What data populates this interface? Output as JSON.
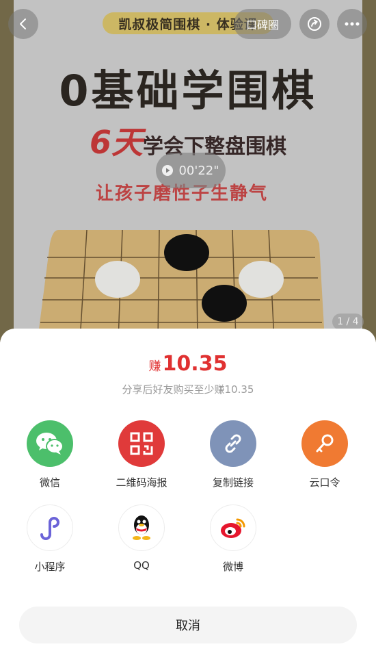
{
  "banner": {
    "tag": "凯叔极简围棋 · 体验课",
    "title": "0基础学围棋",
    "subtitle_num": "6天",
    "subtitle_rest": "学会下整盘围棋",
    "slogan": "让孩子磨性子生静气",
    "audio_duration": "00'22\"",
    "page_indicator": "1 / 4",
    "koubei_label": "口碑圈"
  },
  "share": {
    "earn_label": "赚",
    "earn_amount": "10.35",
    "earn_desc": "分享后好友购买至少赚10.35",
    "options": [
      {
        "label": "微信",
        "icon": "wechat-icon",
        "color": "#4cbf6b"
      },
      {
        "label": "二维码海报",
        "icon": "qrcode-icon",
        "color": "#e03a3a"
      },
      {
        "label": "复制链接",
        "icon": "link-icon",
        "color": "#7f93b8"
      },
      {
        "label": "云口令",
        "icon": "key-icon",
        "color": "#f07a32"
      },
      {
        "label": "小程序",
        "icon": "miniprogram-icon",
        "color": "#6b63d8"
      },
      {
        "label": "QQ",
        "icon": "qq-icon",
        "color": "#000000"
      },
      {
        "label": "微博",
        "icon": "weibo-icon",
        "color": "#e6162d"
      }
    ],
    "cancel_label": "取消"
  }
}
